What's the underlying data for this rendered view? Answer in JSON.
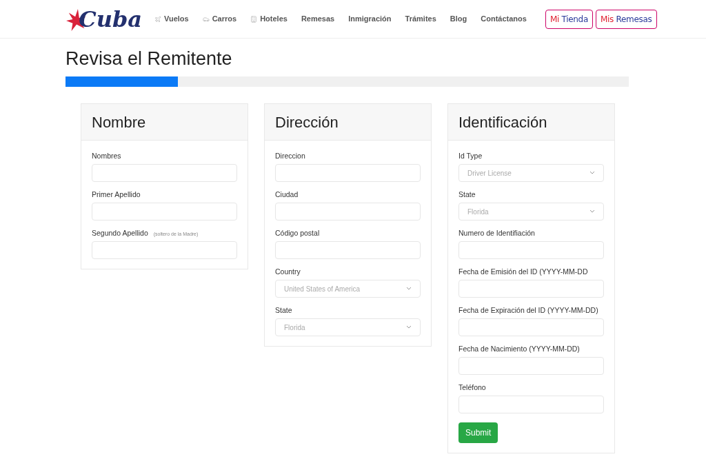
{
  "logo": {
    "text": "Cuba"
  },
  "nav": [
    {
      "label": "Vuelos",
      "kind": "plane"
    },
    {
      "label": "Carros",
      "kind": "car"
    },
    {
      "label": "Hoteles",
      "kind": "building"
    },
    {
      "label": "Remesas"
    },
    {
      "label": "Inmigración"
    },
    {
      "label": "Trámites"
    },
    {
      "label": "Blog"
    },
    {
      "label": "Contáctanos"
    }
  ],
  "badges": [
    {
      "prefix": "Mi",
      "label": "Tienda"
    },
    {
      "prefix": "Mis",
      "label": "Remesas"
    }
  ],
  "page_title": "Revisa el Remitente",
  "progress": {
    "level": 0.2
  },
  "cards": [
    {
      "title": "Nombre",
      "fields": [
        {
          "kind": "input",
          "label": "Nombres"
        },
        {
          "kind": "input",
          "label": "Primer Apellido"
        },
        {
          "kind": "input",
          "label": "Segundo Apellido",
          "note": "(soltero de la Madre)"
        }
      ]
    },
    {
      "title": "Dirección",
      "fields": [
        {
          "kind": "input",
          "label": "Direccion"
        },
        {
          "kind": "input",
          "label": "Ciudad"
        },
        {
          "kind": "input",
          "label": "Código postal"
        },
        {
          "kind": "select",
          "label": "Country",
          "value": "United States of America"
        },
        {
          "kind": "select",
          "label": "State",
          "value": "Florida"
        }
      ]
    },
    {
      "title": "Identificación",
      "fields": [
        {
          "kind": "select",
          "label": "Id Type",
          "value": "Driver License"
        },
        {
          "kind": "select",
          "label": "State",
          "value": "Florida"
        },
        {
          "kind": "input",
          "label": "Numero de Identifiación"
        },
        {
          "kind": "input",
          "label": "Fecha de Emisión del ID (YYYY-MM-DD"
        },
        {
          "kind": "input",
          "label": "Fecha de Expiración del ID (YYYY-MM-DD)"
        },
        {
          "kind": "input",
          "label": "Fecha de Nacimiento (YYYY-MM-DD)"
        },
        {
          "kind": "input",
          "label": "Teléfono"
        }
      ],
      "submit": "Submit"
    }
  ]
}
